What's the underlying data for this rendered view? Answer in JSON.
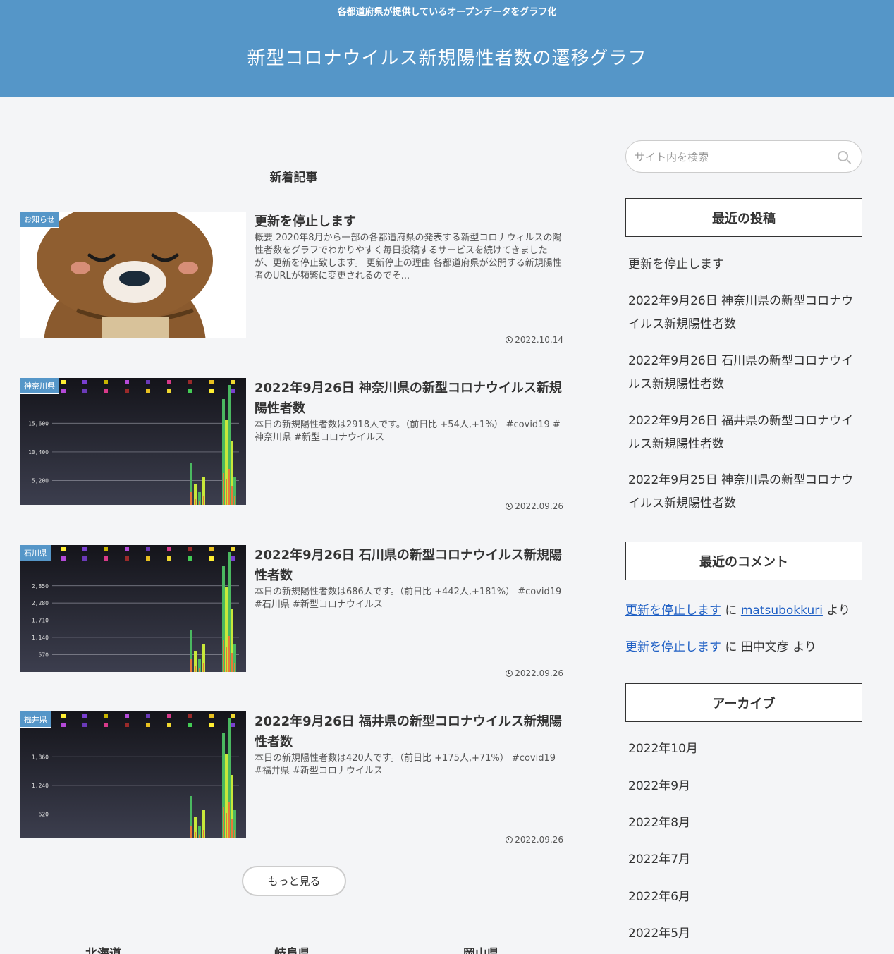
{
  "header": {
    "tagline": "各都道府県が提供しているオープンデータをグラフ化",
    "title": "新型コロナウイルス新規陽性者数の遷移グラフ"
  },
  "main": {
    "section_title": "新着記事",
    "articles": [
      {
        "category": "お知らせ",
        "title": "更新を停止します",
        "snippet": "概要 2020年8月から一部の各都道府県の発表する新型コロナウィルスの陽性者数をグラフでわかりやすく毎日投稿するサービスを続けてきましたが、更新を停止致します。 更新停止の理由 各都道府県が公開する新規陽性者のURLが頻繁に変更されるのでそ...",
        "date": "2022.10.14"
      },
      {
        "category": "神奈川県",
        "title": "2022年9月26日 神奈川県の新型コロナウイルス新規陽性者数",
        "snippet": "本日の新規陽性者数は2918人です。（前日比 +54人,+1%） #covid19 #神奈川県 #新型コロナウイルス",
        "date": "2022.09.26",
        "thumb_ticks": [
          "15,600",
          "10,400",
          "5,200"
        ]
      },
      {
        "category": "石川県",
        "title": "2022年9月26日 石川県の新型コロナウイルス新規陽性者数",
        "snippet": "本日の新規陽性者数は686人です。（前日比 +442人,+181%） #covid19 #石川県 #新型コロナウイルス",
        "date": "2022.09.26",
        "thumb_ticks": [
          "2,850",
          "2,280",
          "1,710",
          "1,140",
          "570"
        ]
      },
      {
        "category": "福井県",
        "title": "2022年9月26日 福井県の新型コロナウイルス新規陽性者数",
        "snippet": "本日の新規陽性者数は420人です。（前日比 +175人,+71%） #covid19 #福井県 #新型コロナウイルス",
        "date": "2022.09.26",
        "thumb_ticks": [
          "1,860",
          "1,240",
          "620"
        ]
      }
    ],
    "more_button": "もっと見る",
    "prefectures": [
      "北海道",
      "岐阜県",
      "岡山県"
    ]
  },
  "sidebar": {
    "search_placeholder": "サイト内を検索",
    "recent_posts_title": "最近の投稿",
    "recent_posts": [
      "更新を停止します",
      "2022年9月26日 神奈川県の新型コロナウイルス新規陽性者数",
      "2022年9月26日 石川県の新型コロナウイルス新規陽性者数",
      "2022年9月26日 福井県の新型コロナウイルス新規陽性者数",
      "2022年9月25日 神奈川県の新型コロナウイルス新規陽性者数"
    ],
    "recent_comments_title": "最近のコメント",
    "comments": [
      {
        "post": "更新を停止します",
        "ni": "に",
        "author": "matsubokkuri",
        "author_link": true,
        "yori": "より"
      },
      {
        "post": "更新を停止します",
        "ni": "に",
        "author": "田中文彦",
        "author_link": false,
        "yori": "より"
      }
    ],
    "archive_title": "アーカイブ",
    "archives": [
      "2022年10月",
      "2022年9月",
      "2022年8月",
      "2022年7月",
      "2022年6月",
      "2022年5月"
    ]
  },
  "colors": {
    "header_bg": "#5596c8",
    "category_badge": "#5596c8",
    "link": "#1e5fc4",
    "page_bg": "#f4f5f7"
  }
}
